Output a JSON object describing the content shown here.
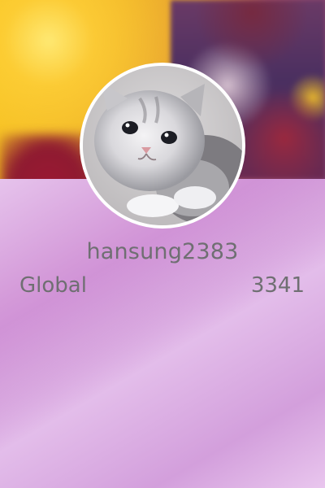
{
  "profile": {
    "username": "hansung2383",
    "rank_label": "Global",
    "rank_value": "3341"
  },
  "colors": {
    "text": "#6f6f72",
    "panel_accent": "#c883d1",
    "avatar_border": "#ffffff"
  },
  "icons": {
    "avatar": "kitten-photo",
    "banner": "anime-banner-image"
  }
}
